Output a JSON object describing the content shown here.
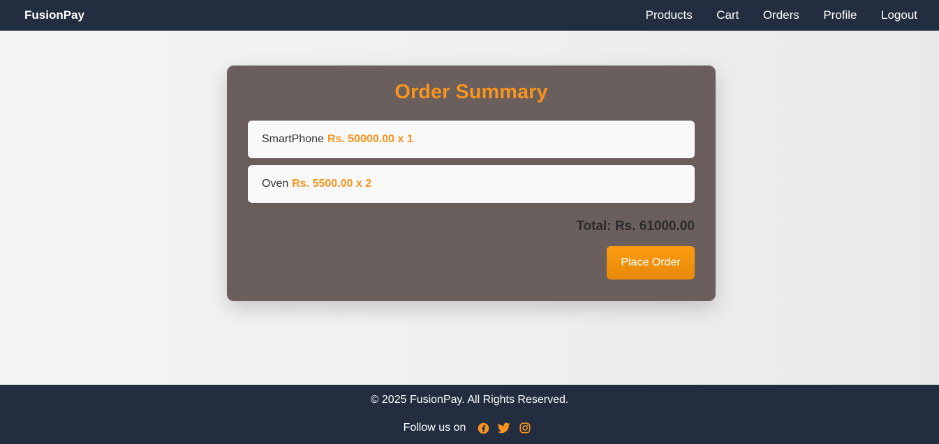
{
  "navbar": {
    "brand": "FusionPay",
    "links": [
      "Products",
      "Cart",
      "Orders",
      "Profile",
      "Logout"
    ]
  },
  "order_summary": {
    "title": "Order Summary",
    "items": [
      {
        "name": "SmartPhone",
        "price": "Rs. 50000.00",
        "qty": "x 1"
      },
      {
        "name": "Oven",
        "price": "Rs. 5500.00",
        "qty": "x 2"
      }
    ],
    "total": "Total: Rs. 61000.00",
    "button_label": "Place Order"
  },
  "footer": {
    "copyright": "© 2025 FusionPay. All Rights Reserved.",
    "follow_text": "Follow us on",
    "social_icons": [
      "facebook-icon",
      "twitter-icon",
      "instagram-icon"
    ]
  },
  "colors": {
    "navbar_bg": "#222e3f",
    "card_bg": "#6a5f5d",
    "accent": "#f7931e"
  }
}
